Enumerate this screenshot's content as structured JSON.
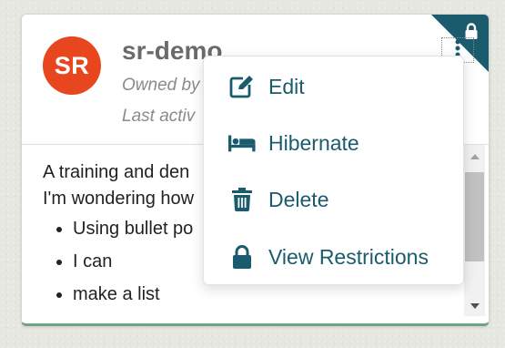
{
  "card": {
    "avatar_initials": "SR",
    "title": "sr-demo",
    "owned_text": "Owned by",
    "last_active_text": "Last activ",
    "description_lines": [
      "A training and den",
      "I'm wondering how"
    ],
    "bullets": [
      "Using bullet po",
      "I can",
      "make a list"
    ],
    "corner_icon": "lock-icon",
    "menu_trigger_icon": "kebab-icon"
  },
  "menu": {
    "items": [
      {
        "label": "Edit",
        "icon": "edit-icon"
      },
      {
        "label": "Hibernate",
        "icon": "bed-icon"
      },
      {
        "label": "Delete",
        "icon": "trash-icon"
      },
      {
        "label": "View Restrictions",
        "icon": "lock-icon"
      }
    ]
  },
  "colors": {
    "accent": "#1a5b6d",
    "avatar": "#e8461f",
    "card_border_bottom": "#6fa57c"
  }
}
